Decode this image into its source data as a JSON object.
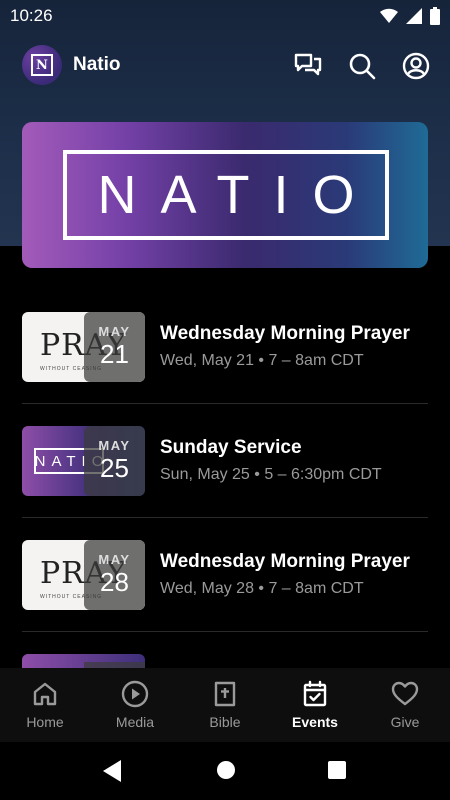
{
  "status_bar": {
    "time": "10:26"
  },
  "app_bar": {
    "logo_letter": "N",
    "title": "Natio"
  },
  "banner": {
    "text": "NATIO"
  },
  "events": [
    {
      "month": "MAY",
      "day": "21",
      "title": "Wednesday Morning Prayer",
      "subtitle": "Wed, May 21 • 7 – 8am CDT",
      "thumb": "pray"
    },
    {
      "month": "MAY",
      "day": "25",
      "title": "Sunday Service",
      "subtitle": "Sun, May 25 • 5 – 6:30pm CDT",
      "thumb": "natio"
    },
    {
      "month": "MAY",
      "day": "28",
      "title": "Wednesday Morning Prayer",
      "subtitle": "Wed, May 28 • 7 – 8am CDT",
      "thumb": "pray"
    }
  ],
  "thumbs": {
    "pray_text": "PRAY",
    "pray_small": "WITHOUT CEASING",
    "natio_text": "NATIO"
  },
  "bottom_nav": [
    {
      "label": "Home",
      "icon": "home-icon",
      "active": false
    },
    {
      "label": "Media",
      "icon": "play-circle-icon",
      "active": false
    },
    {
      "label": "Bible",
      "icon": "bible-icon",
      "active": false
    },
    {
      "label": "Events",
      "icon": "calendar-check-icon",
      "active": true
    },
    {
      "label": "Give",
      "icon": "heart-icon",
      "active": false
    }
  ],
  "colors": {
    "header_bg": "#1d2f4a",
    "accent": "#7541a8"
  }
}
